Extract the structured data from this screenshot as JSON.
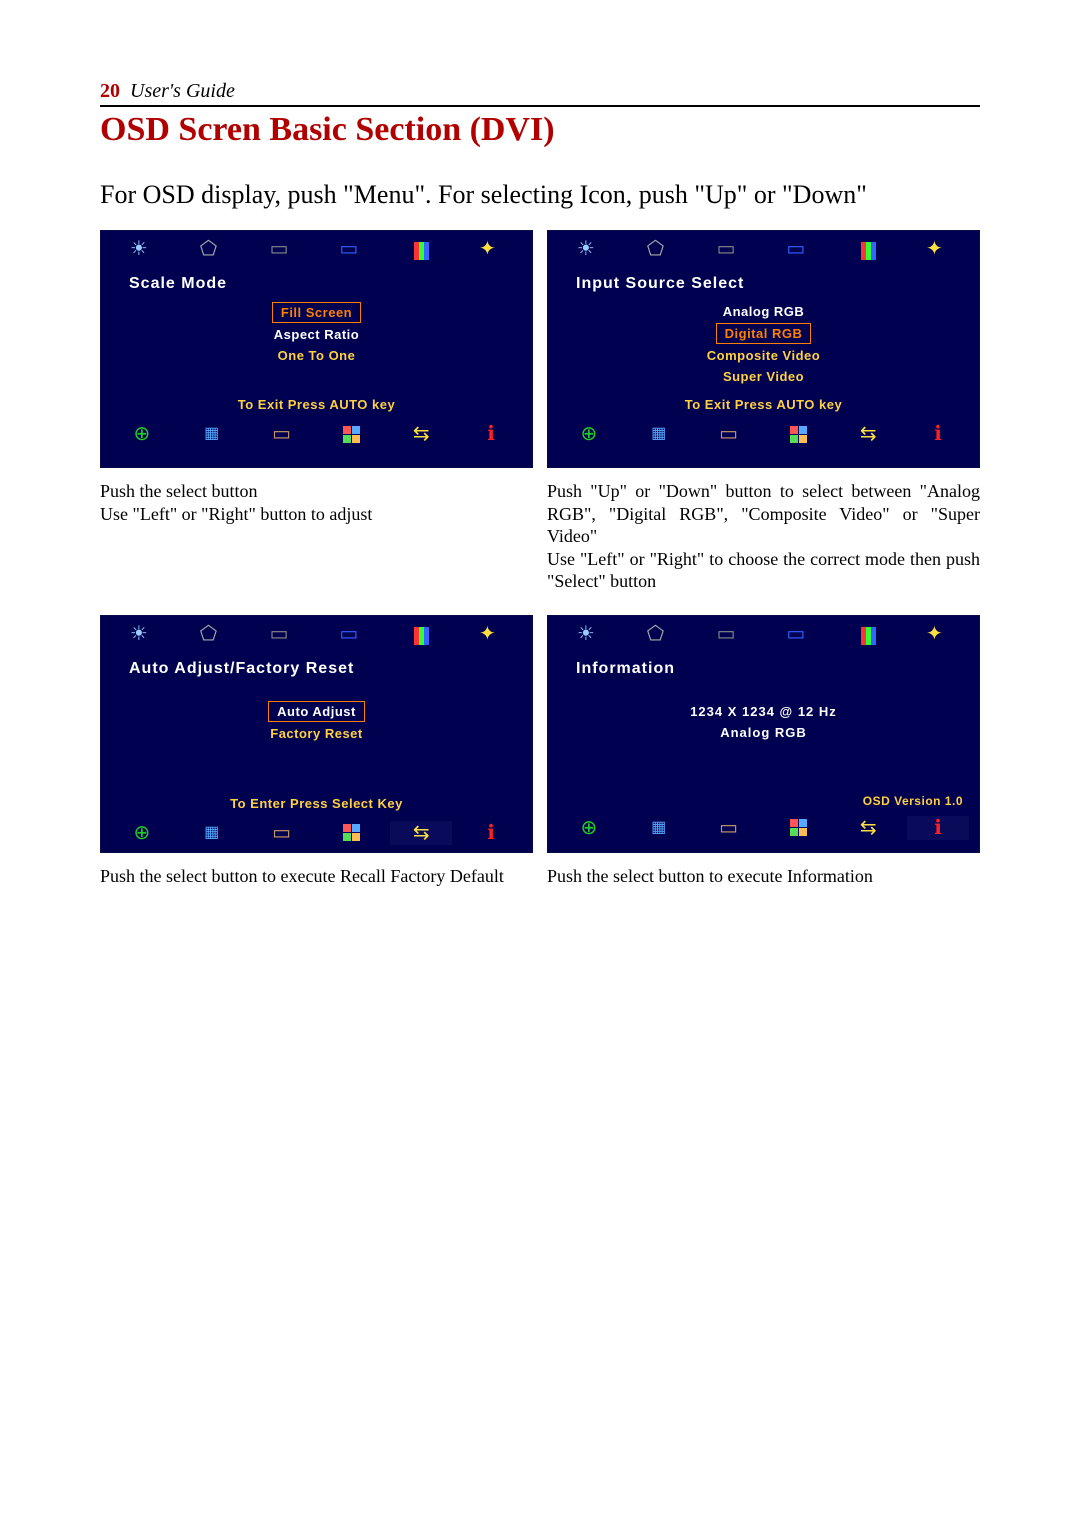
{
  "header": {
    "page_number": "20",
    "guide_label": "User's Guide"
  },
  "title": "OSD Scren Basic Section (DVI)",
  "intro": "For OSD display, push \"Menu\".  For selecting Icon, push \"Up\" or \"Down\"",
  "panels": {
    "scale": {
      "title": "Scale   Mode",
      "options": [
        "Fill Screen",
        "Aspect Ratio",
        "One To One"
      ],
      "hint": "To Exit Press AUTO key",
      "caption": "Push the select button\nUse \"Left\" or \"Right\" button to adjust"
    },
    "input": {
      "title": "Input   Source   Select",
      "options": [
        "Analog RGB",
        "Digital RGB",
        "Composite Video",
        "Super Video"
      ],
      "hint": "To Exit Press AUTO key",
      "caption": "Push \"Up\" or \"Down\" button to select between \"Analog RGB\", \"Digital RGB\", \"Composite Video\" or \"Super Video\"\nUse \"Left\" or \"Right\" to choose the correct mode then push \"Select\" button"
    },
    "auto": {
      "title": "Auto   Adjust/Factory   Reset",
      "options": [
        "Auto Adjust",
        "Factory Reset"
      ],
      "hint": "To Enter Press Select Key",
      "caption": "Push the select button to execute Recall Factory Default"
    },
    "info": {
      "title": "Information",
      "resolution_line": "1234   X   1234   @   12 Hz",
      "mode_line": "Analog RGB",
      "version": "OSD Version 1.0",
      "caption": "Push the select button to execute Information"
    }
  },
  "top_icons": [
    "brightness",
    "geometry",
    "display1",
    "display2",
    "color-bars",
    "tools"
  ],
  "bottom_icons": [
    "zoom-plus",
    "grid",
    "display",
    "squares",
    "arrows",
    "info"
  ]
}
